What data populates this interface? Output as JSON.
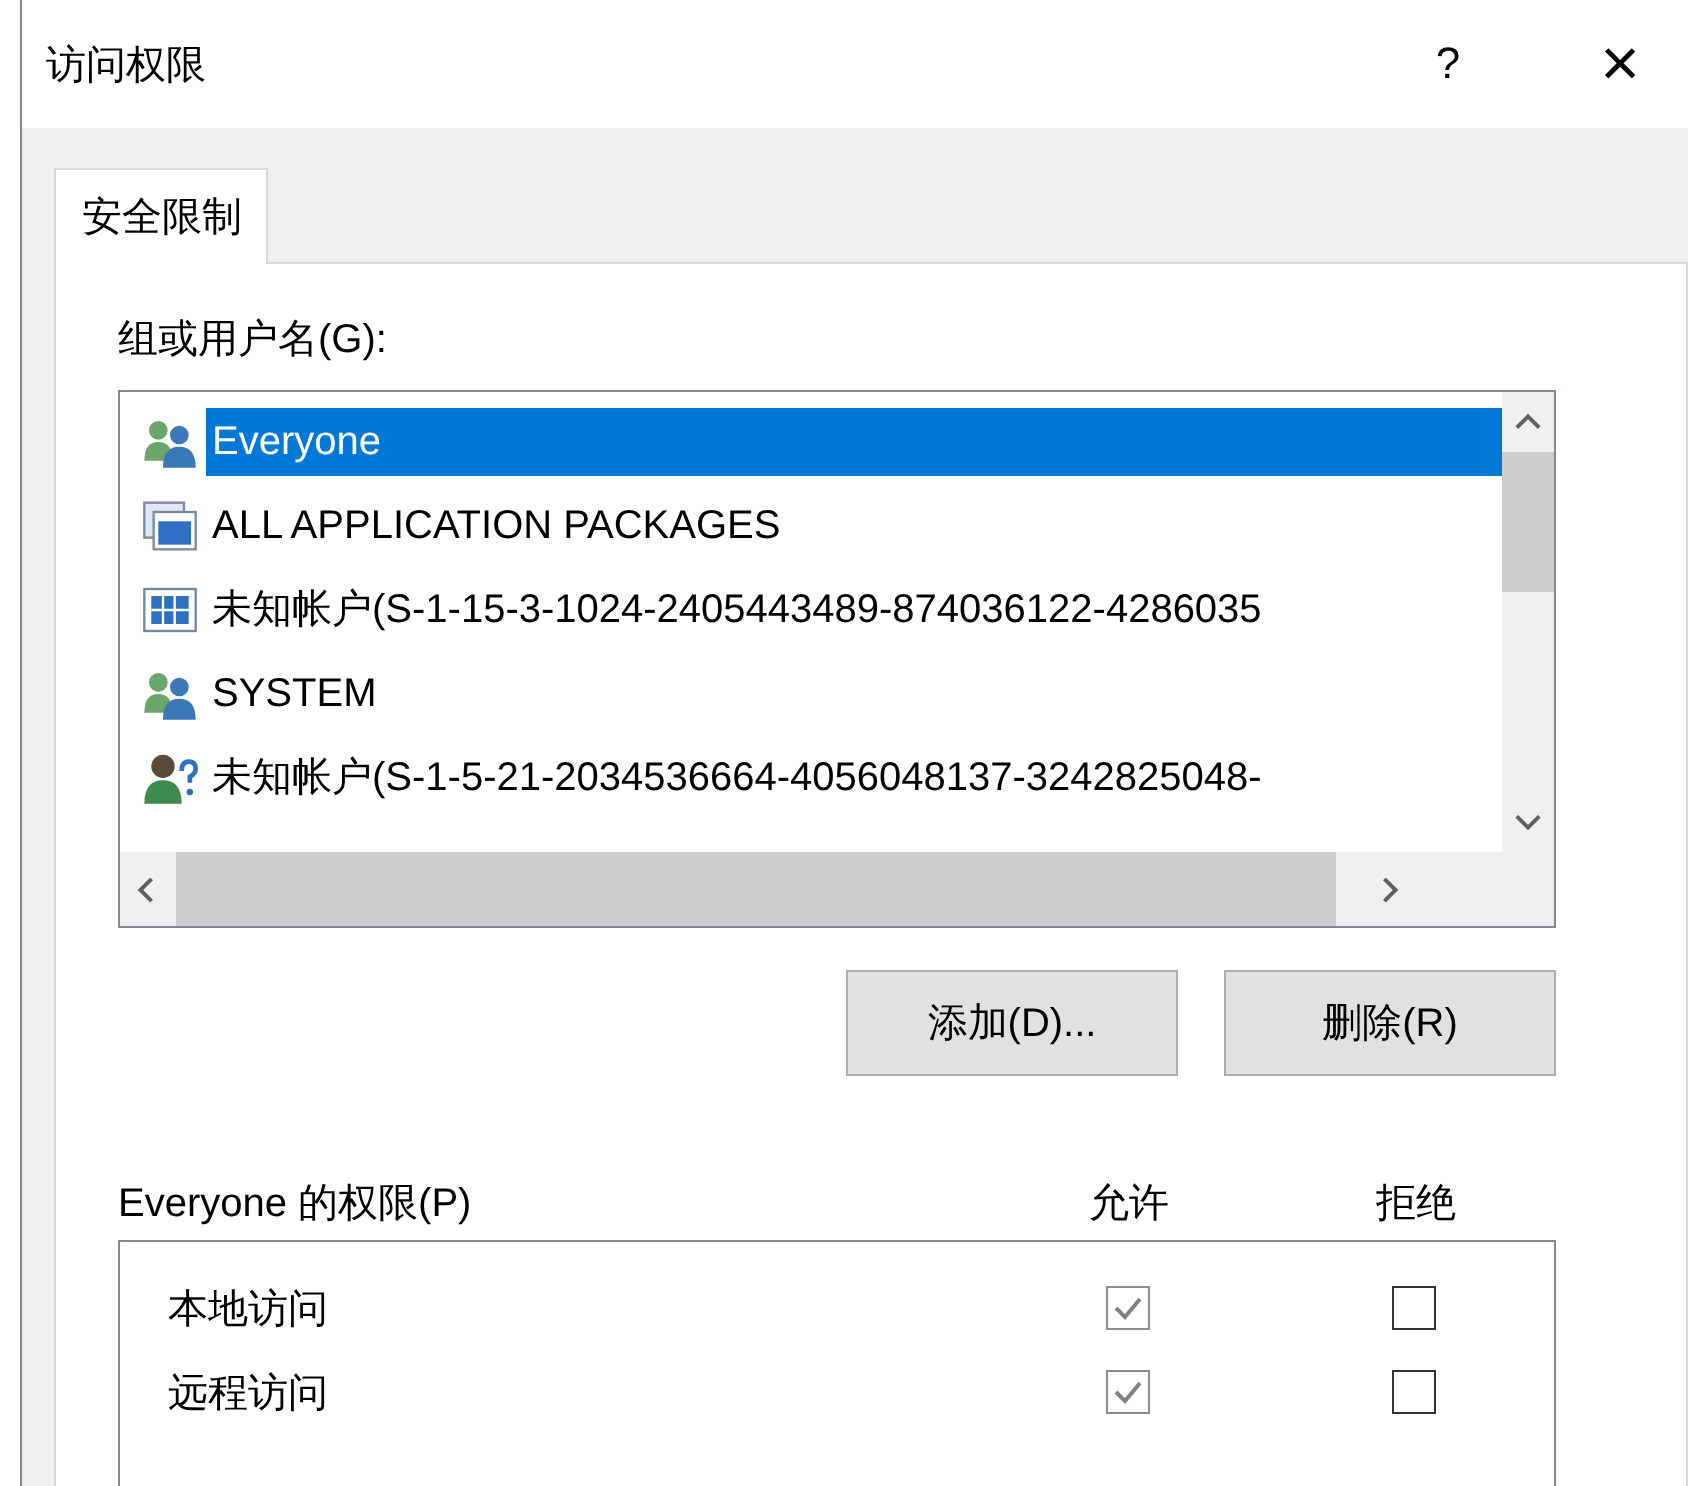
{
  "window": {
    "title": "访问权限",
    "help": "?",
    "close": "×"
  },
  "tabs": [
    {
      "label": "安全限制",
      "selected": true
    }
  ],
  "principals": {
    "label": "组或用户名(G):",
    "items": [
      {
        "kind": "group",
        "name": "Everyone",
        "selected": true
      },
      {
        "kind": "packages",
        "name": "ALL APPLICATION PACKAGES",
        "selected": false
      },
      {
        "kind": "app",
        "name": "未知帐户(S-1-15-3-1024-2405443489-874036122-4286035",
        "selected": false
      },
      {
        "kind": "group",
        "name": "SYSTEM",
        "selected": false
      },
      {
        "kind": "unknown-user",
        "name": "未知帐户(S-1-5-21-2034536664-4056048137-3242825048-",
        "selected": false
      }
    ]
  },
  "buttons": [
    "添加(D)...",
    "删除(R)"
  ],
  "permissions": {
    "label": "Everyone 的权限(P)",
    "columns": [
      "允许",
      "拒绝"
    ],
    "rows": [
      {
        "name": "本地访问",
        "allow": {
          "checked": true,
          "disabled": true
        },
        "deny": {
          "checked": false,
          "disabled": false
        }
      },
      {
        "name": "远程访问",
        "allow": {
          "checked": true,
          "disabled": true
        },
        "deny": {
          "checked": false,
          "disabled": false
        }
      }
    ]
  }
}
